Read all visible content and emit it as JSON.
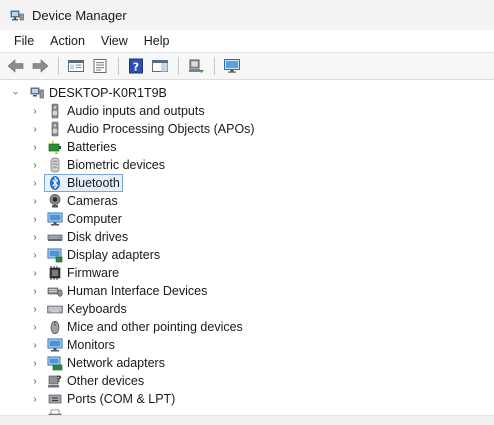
{
  "window": {
    "title": "Device Manager",
    "icon": "device-manager-icon"
  },
  "menu": [
    "File",
    "Action",
    "View",
    "Help"
  ],
  "toolbar": {
    "buttons": [
      "back-icon",
      "forward-icon",
      "properties-pane-icon",
      "update-driver-icon",
      "help-icon",
      "action-pane-icon",
      "scan-hardware-icon",
      "monitor-icon"
    ]
  },
  "tree": {
    "root": "DESKTOP-K0R1T9B",
    "items": [
      {
        "label": "Audio inputs and outputs",
        "icon": "speaker-icon"
      },
      {
        "label": "Audio Processing Objects (APOs)",
        "icon": "speaker-icon"
      },
      {
        "label": "Batteries",
        "icon": "battery-icon"
      },
      {
        "label": "Biometric devices",
        "icon": "fingerprint-icon"
      },
      {
        "label": "Bluetooth",
        "icon": "bluetooth-icon",
        "selected": true
      },
      {
        "label": "Cameras",
        "icon": "camera-icon"
      },
      {
        "label": "Computer",
        "icon": "computer-icon"
      },
      {
        "label": "Disk drives",
        "icon": "disk-drive-icon"
      },
      {
        "label": "Display adapters",
        "icon": "display-adapter-icon"
      },
      {
        "label": "Firmware",
        "icon": "firmware-icon"
      },
      {
        "label": "Human Interface Devices",
        "icon": "hid-icon"
      },
      {
        "label": "Keyboards",
        "icon": "keyboard-icon"
      },
      {
        "label": "Mice and other pointing devices",
        "icon": "mouse-icon"
      },
      {
        "label": "Monitors",
        "icon": "monitor-icon"
      },
      {
        "label": "Network adapters",
        "icon": "network-adapter-icon"
      },
      {
        "label": "Other devices",
        "icon": "unknown-device-icon"
      },
      {
        "label": "Ports (COM & LPT)",
        "icon": "port-icon"
      }
    ]
  },
  "colors": {
    "selection_border": "#7aa7d8",
    "selection_fill": "#e8f1fb",
    "accent_blue": "#1e6fd0"
  }
}
